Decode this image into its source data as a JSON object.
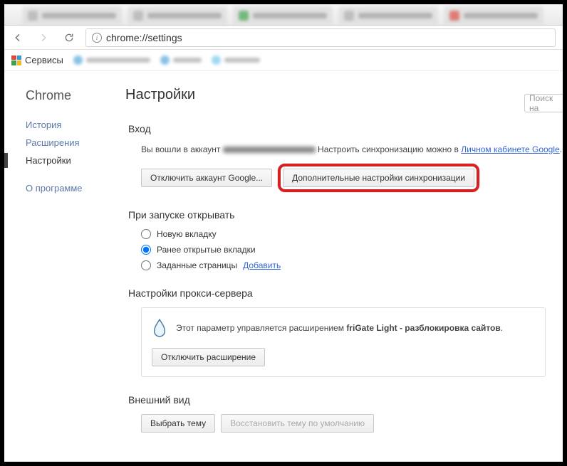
{
  "omnibox": {
    "url": "chrome://settings"
  },
  "bookmarks": {
    "apps_label": "Сервисы"
  },
  "sidebar": {
    "logo": "Chrome",
    "items": [
      {
        "label": "История",
        "active": false
      },
      {
        "label": "Расширения",
        "active": false
      },
      {
        "label": "Настройки",
        "active": true
      }
    ],
    "about": "О программе"
  },
  "page": {
    "title": "Настройки",
    "search_placeholder": "Поиск на"
  },
  "login": {
    "heading": "Вход",
    "text_before": "Вы вошли в аккаунт ",
    "text_after": " Настроить синхронизацию можно в ",
    "link": "Личном кабинете Google",
    "period": ".",
    "btn_disconnect": "Отключить аккаунт Google...",
    "btn_sync": "Дополнительные настройки синхронизации"
  },
  "startup": {
    "heading": "При запуске открывать",
    "opt_newtab": "Новую вкладку",
    "opt_prev": "Ранее открытые вкладки",
    "opt_specific": "Заданные страницы ",
    "opt_specific_link": "Добавить",
    "selected": "prev"
  },
  "proxy": {
    "heading": "Настройки прокси-сервера",
    "text_before": "Этот параметр управляется расширением ",
    "ext_name": "friGate Light - разблокировка сайтов",
    "period": ".",
    "btn_disable": "Отключить расширение"
  },
  "appearance": {
    "heading": "Внешний вид",
    "btn_choose": "Выбрать тему",
    "btn_restore": "Восстановить тему по умолчанию"
  }
}
